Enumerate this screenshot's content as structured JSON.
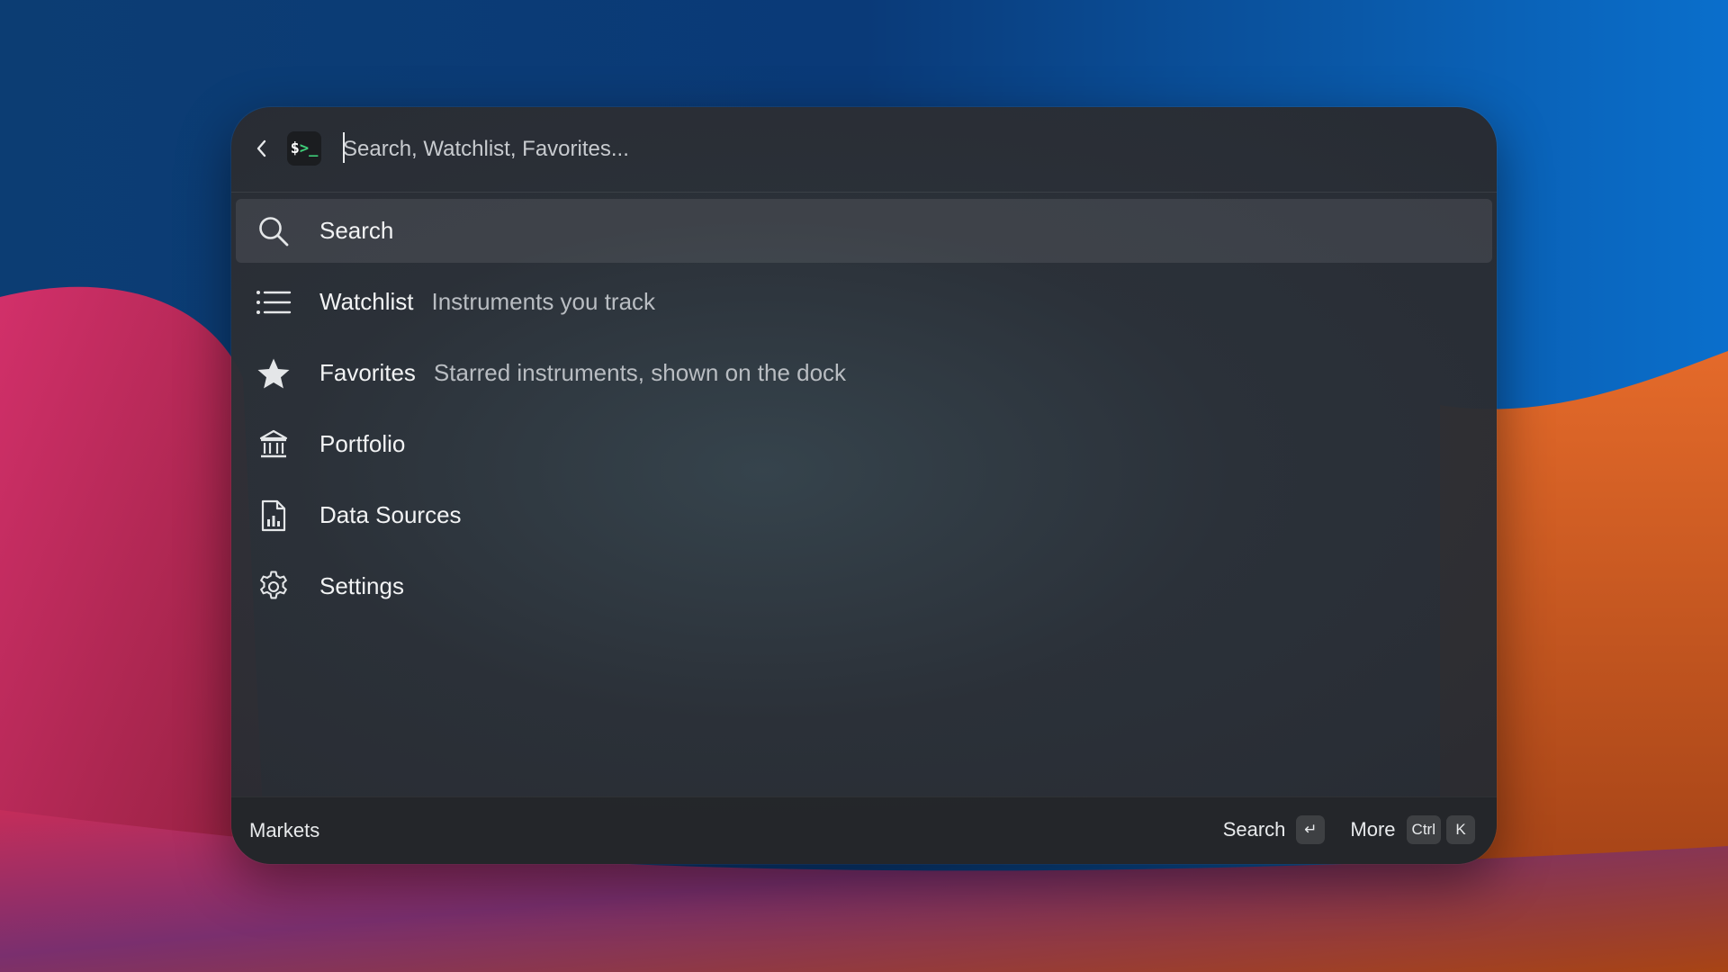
{
  "header": {
    "app_icon_text": "$",
    "app_icon_cursor": ">_",
    "search_placeholder": "Search, Watchlist, Favorites..."
  },
  "items": [
    {
      "label": "Search",
      "subtitle": "",
      "icon": "search-icon",
      "selected": true
    },
    {
      "label": "Watchlist",
      "subtitle": "Instruments you track",
      "icon": "list-icon",
      "selected": false
    },
    {
      "label": "Favorites",
      "subtitle": "Starred instruments, shown on the dock",
      "icon": "star-icon",
      "selected": false
    },
    {
      "label": "Portfolio",
      "subtitle": "",
      "icon": "bank-icon",
      "selected": false
    },
    {
      "label": "Data Sources",
      "subtitle": "",
      "icon": "chart-file-icon",
      "selected": false
    },
    {
      "label": "Settings",
      "subtitle": "",
      "icon": "gear-icon",
      "selected": false
    }
  ],
  "footer": {
    "title": "Markets",
    "primary_action": "Search",
    "primary_key": "↵",
    "secondary_action": "More",
    "secondary_keys": [
      "Ctrl",
      "K"
    ]
  },
  "colors": {
    "panel": "#2c3036",
    "selected_row": "#41464c",
    "text": "#f2f3f4",
    "subtitle": "#b9bdc2",
    "prompt_green": "#3fd07a"
  }
}
